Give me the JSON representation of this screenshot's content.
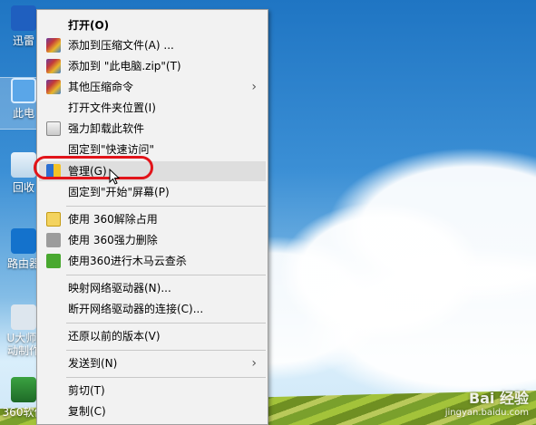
{
  "desktop": {
    "icons": [
      {
        "label": "迅雷"
      },
      {
        "label": "此电"
      },
      {
        "label": "回收"
      },
      {
        "label": "路由器"
      },
      {
        "label": "U大师-\n动制作"
      },
      {
        "label": "360软件"
      }
    ]
  },
  "context_menu": {
    "items": [
      {
        "label": "打开(O)"
      },
      {
        "label": "添加到压缩文件(A) ..."
      },
      {
        "label": "添加到 \"此电脑.zip\"(T)"
      },
      {
        "label": "其他压缩命令"
      },
      {
        "label": "打开文件夹位置(I)"
      },
      {
        "label": "强力卸载此软件"
      },
      {
        "label": "固定到\"快速访问\""
      },
      {
        "label": "管理(G)"
      },
      {
        "label": "固定到\"开始\"屏幕(P)"
      },
      {
        "label": "使用 360解除占用"
      },
      {
        "label": "使用 360强力删除"
      },
      {
        "label": "使用360进行木马云查杀"
      },
      {
        "label": "映射网络驱动器(N)..."
      },
      {
        "label": "断开网络驱动器的连接(C)..."
      },
      {
        "label": "还原以前的版本(V)"
      },
      {
        "label": "发送到(N)"
      },
      {
        "label": "剪切(T)"
      },
      {
        "label": "复制(C)"
      }
    ],
    "submenu_arrow": "›"
  },
  "watermark": {
    "brand": "Bai 经验",
    "url": "jingyan.baidu.com"
  },
  "colors": {
    "highlight_ring": "#e2141a",
    "menu_bg": "#f2f2f2",
    "hover_bg": "#dedede"
  }
}
